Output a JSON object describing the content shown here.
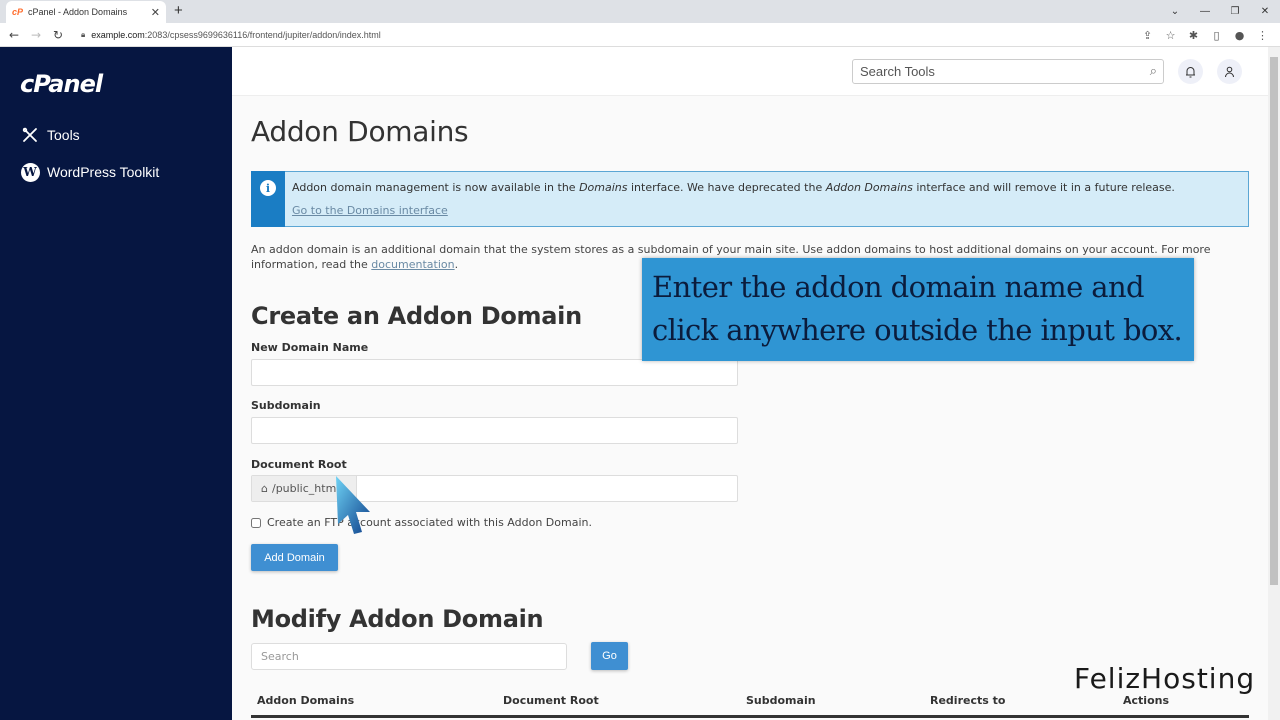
{
  "browser": {
    "tab_title": "cPanel - Addon Domains",
    "favicon": "cP",
    "url_host": "example.com",
    "url_path": ":2083/cpsess9699636116/frontend/jupiter/addon/index.html"
  },
  "sidebar": {
    "logo": "cPanel",
    "items": [
      {
        "label": "Tools",
        "icon": "tools-icon"
      },
      {
        "label": "WordPress Toolkit",
        "icon": "wordpress-icon"
      }
    ]
  },
  "header": {
    "search_placeholder": "Search Tools"
  },
  "page": {
    "title": "Addon Domains",
    "alert": {
      "text_1": "Addon domain management is now available in the ",
      "em_1": "Domains",
      "text_2": " interface. We have deprecated the ",
      "em_2": "Addon Domains",
      "text_3": " interface and will remove it in a future release.",
      "link": "Go to the Domains interface"
    },
    "description": "An addon domain is an additional domain that the system stores as a subdomain of your main site. Use addon domains to host additional domains on your account. For more information, read the ",
    "description_link": "documentation",
    "description_end": "."
  },
  "create": {
    "heading": "Create an Addon Domain",
    "new_domain_label": "New Domain Name",
    "new_domain_value": "",
    "subdomain_label": "Subdomain",
    "subdomain_value": "",
    "docroot_label": "Document Root",
    "docroot_prefix": "/public_html",
    "docroot_value": "",
    "ftp_checkbox_label": "Create an FTP account associated with this Addon Domain.",
    "ftp_checked": false,
    "add_button": "Add Domain"
  },
  "modify": {
    "heading": "Modify Addon Domain",
    "search_placeholder": "Search",
    "go_button": "Go",
    "columns": [
      "Addon Domains",
      "Document Root",
      "Subdomain",
      "Redirects to",
      "Actions"
    ]
  },
  "overlay": {
    "callout": "Enter the addon domain name and click anywhere outside the input box.",
    "watermark": "FelizHosting"
  },
  "colors": {
    "sidebar_bg": "#061641",
    "primary_button": "#3f8fd2",
    "alert_bg": "#d5ecf8",
    "alert_bar": "#1a7dc4",
    "callout_bg": "#2f95d3"
  }
}
